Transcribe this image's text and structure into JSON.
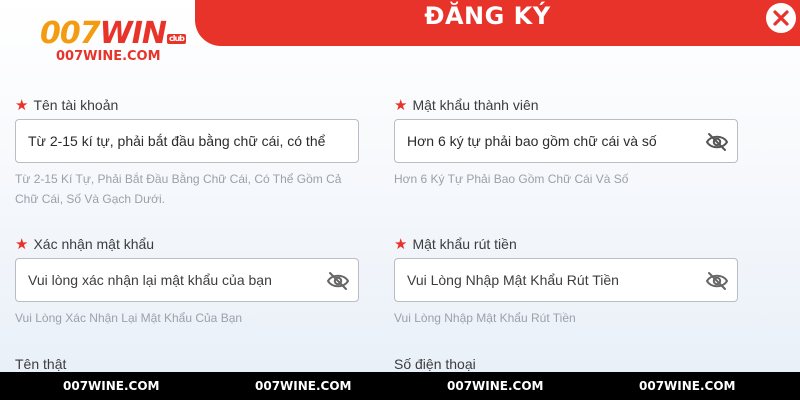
{
  "header": {
    "title": "ĐĂNG KÝ",
    "close_icon": "close-icon",
    "accent_color": "#e8332b"
  },
  "logo": {
    "text_num": "007",
    "text_win": "WIN",
    "badge": "club",
    "subtext": "007WINE.COM"
  },
  "form": {
    "username": {
      "label": "Tên tài khoản",
      "value": "Từ 2-15 kí tự, phải bắt đầu bằng chữ cái, có thể",
      "hint": "Từ 2-15 Kí Tự, Phải Bắt Đầu Bằng Chữ Cái, Có Thể Gồm Cả Chữ Cái, Số Và Gạch Dưới."
    },
    "password": {
      "label": "Mật khẩu thành viên",
      "value": "Hơn 6 ký tự phải bao gồm chữ cái và số",
      "hint": "Hơn 6 Ký Tự Phải Bao Gồm Chữ Cái Và Số",
      "icon": "eye-slash-icon"
    },
    "confirm_password": {
      "label": "Xác nhận mật khẩu",
      "value": "Vui lòng xác nhận lại mật khẩu của bạn",
      "hint": "Vui Lòng Xác Nhận Lại Mật Khẩu Của Bạn",
      "icon": "eye-slash-icon"
    },
    "withdraw_password": {
      "label": "Mật khẩu rút tiền",
      "value": "Vui Lòng Nhập Mật Khẩu Rút Tiền",
      "hint": "Vui Lòng Nhập Mật Khẩu Rút Tiền",
      "icon": "eye-slash-icon"
    },
    "real_name": {
      "label": "Tên thật"
    },
    "phone": {
      "label": "Số điện thoại"
    }
  },
  "footer": {
    "items": [
      "007WINE.COM",
      "007WINE.COM",
      "007WINE.COM",
      "007WINE.COM"
    ]
  }
}
